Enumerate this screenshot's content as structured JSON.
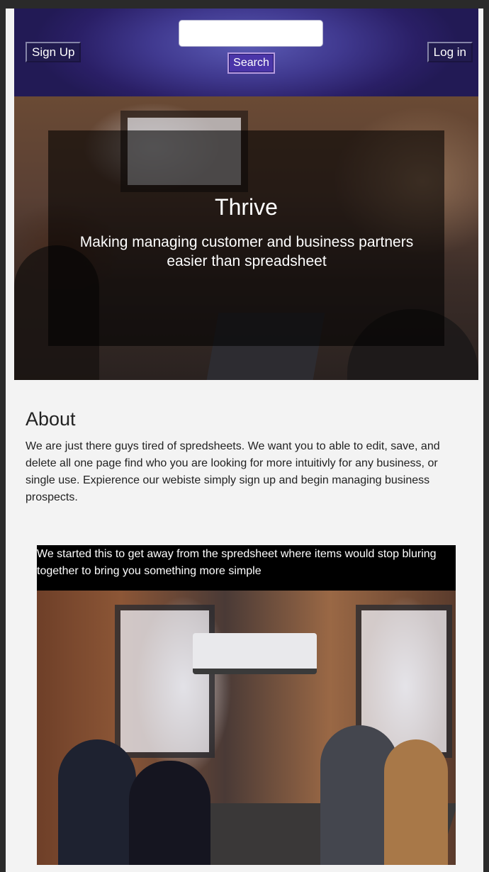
{
  "header": {
    "signup_label": "Sign Up",
    "login_label": "Log in",
    "search_placeholder": "",
    "search_button_label": "Search"
  },
  "hero": {
    "title": "Thrive",
    "subtitle": "Making managing customer and business partners easier than spreadsheet"
  },
  "about": {
    "title": "About",
    "text": "We are just there guys tired of spredsheets. We want you to able to edit, save, and delete all one page find who you are looking for more intuitivly for any business, or single use. Expierence our webiste simply sign up and begin managing business prospects."
  },
  "feature": {
    "caption": "We started this to get away from the spredsheet where items would stop bluring together to bring you something more simple"
  },
  "colors": {
    "header_accent": "#40398f",
    "search_button": "#4a35a8",
    "page_background": "#f3f3f3"
  }
}
